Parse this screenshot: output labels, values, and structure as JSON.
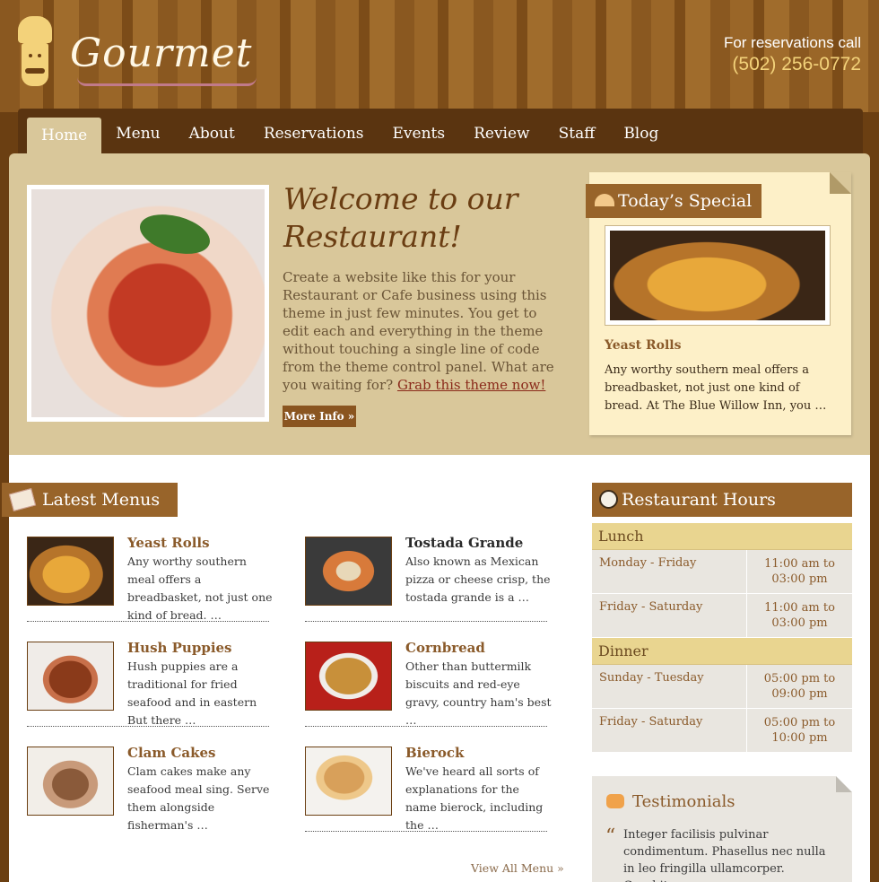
{
  "brand": {
    "name": "Gourmet"
  },
  "reservations": {
    "label": "For reservations call",
    "phone": "(502) 256-0772"
  },
  "nav": {
    "items": [
      "Home",
      "Menu",
      "About",
      "Reservations",
      "Events",
      "Review",
      "Staff",
      "Blog"
    ],
    "active": "Home"
  },
  "hero": {
    "title_line1": "Welcome to our",
    "title_line2": "Restaurant!",
    "text": "Create a website like this for your Restaurant or Cafe business using this theme in just few minutes. You get to edit each and everything in the theme without touching a single line of code from the theme control panel. What are you waiting for?",
    "link": "Grab this theme now!",
    "button": "More Info »"
  },
  "special": {
    "heading": "Today’s Special",
    "title": "Yeast Rolls",
    "text": "Any worthy southern meal offers a breadbasket, not just one kind of bread. At The Blue Willow Inn, you …"
  },
  "latest_menus": {
    "heading": "Latest Menus",
    "items": [
      {
        "title": "Yeast Rolls",
        "desc": "Any worthy southern meal offers a breadbasket, not just one kind of bread. …"
      },
      {
        "title": "Tostada Grande",
        "desc": "Also known as Mexican pizza or cheese crisp, the tostada grande is a …"
      },
      {
        "title": "Hush Puppies",
        "desc": "Hush puppies are a traditional for fried seafood and in eastern But there …"
      },
      {
        "title": "Cornbread",
        "desc": "Other than buttermilk biscuits and red-eye gravy, country ham's best …"
      },
      {
        "title": "Clam Cakes",
        "desc": "Clam cakes make any seafood meal sing. Serve them alongside fisherman's …"
      },
      {
        "title": "Bierock",
        "desc": "We've heard all sorts of explanations for the name bierock, including the …"
      }
    ],
    "view_all": "View All Menu »"
  },
  "hours": {
    "heading": "Restaurant Hours",
    "lunch": {
      "label": "Lunch",
      "rows": [
        {
          "day": "Monday - Friday",
          "time": "11:00 am to 03:00 pm"
        },
        {
          "day": "Friday - Saturday",
          "time": "11:00 am to 03:00 pm"
        }
      ]
    },
    "dinner": {
      "label": "Dinner",
      "rows": [
        {
          "day": "Sunday - Tuesday",
          "time": "05:00 pm to 09:00 pm"
        },
        {
          "day": "Friday - Saturday",
          "time": "05:00 pm to 10:00 pm"
        }
      ]
    }
  },
  "testimonials": {
    "heading": "Testimonials",
    "text": "Integer facilisis pulvinar condimentum. Phasellus nec nulla in leo fringilla ullamcorper. Curabitur"
  }
}
